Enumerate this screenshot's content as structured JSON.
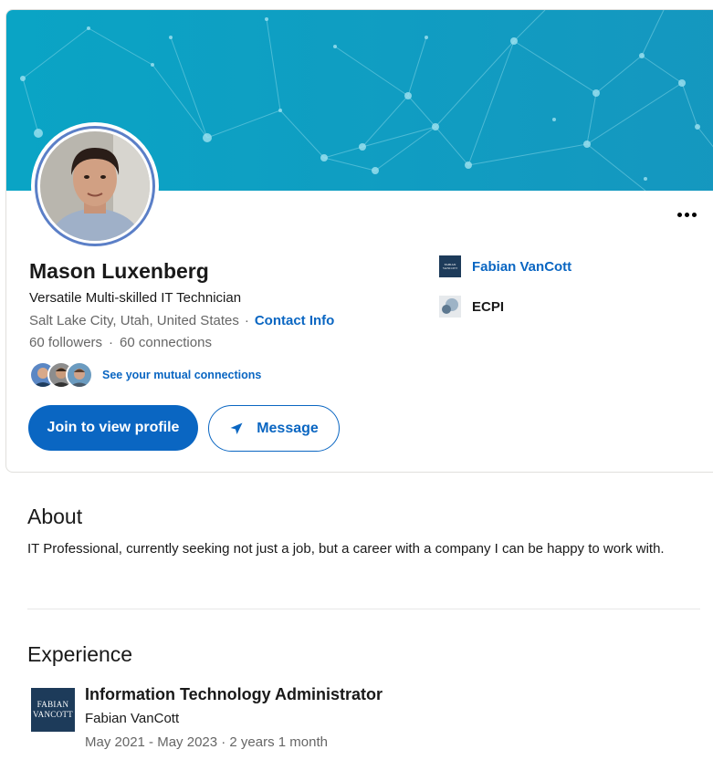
{
  "profile": {
    "name": "Mason Luxenberg",
    "headline": "Versatile Multi-skilled IT Technician",
    "location": "Salt Lake City, Utah, United States",
    "separator": "·",
    "contact_info": "Contact Info",
    "followers": "60 followers",
    "connections": "60 connections",
    "mutual_link": "See your mutual connections"
  },
  "actions": {
    "join_label": "Join to view profile",
    "message_label": "Message"
  },
  "orgs": [
    {
      "name": "Fabian VanCott",
      "icon": "fabian-vancott-logo",
      "logo_text": "FABIAN VANCOTT"
    },
    {
      "name": "ECPI",
      "icon": "ecpi-logo"
    }
  ],
  "about": {
    "title": "About",
    "text": "IT Professional, currently seeking not just a job, but a career with a company I can be happy to work with."
  },
  "experience": {
    "title": "Experience",
    "items": [
      {
        "role": "Information Technology Administrator",
        "company": "Fabian VanCott",
        "logo_line1": "FABIAN",
        "logo_line2": "VANCOTT",
        "start": "May 2021",
        "end": "May 2023",
        "dash": " - ",
        "duration": " · 2 years 1 month"
      }
    ]
  },
  "colors": {
    "accent": "#0a66c2",
    "banner_start": "#0aa6c4",
    "banner_end": "#1296bf",
    "logo_navy": "#1d3b5a"
  }
}
